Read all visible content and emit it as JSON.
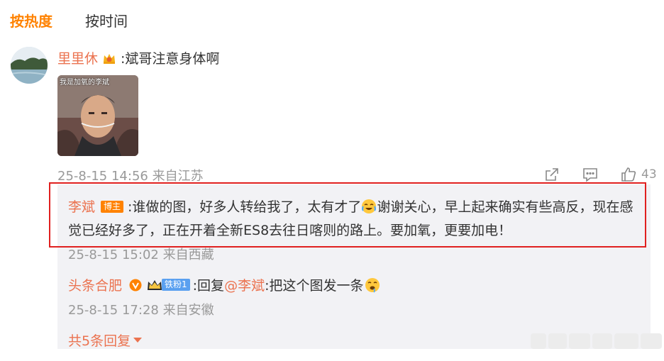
{
  "tabs": {
    "hot": "按热度",
    "time": "按时间"
  },
  "comment": {
    "username": "里里休",
    "text": ":斌哥注意身体啊",
    "image_caption": "我是加氧的李斌",
    "timestamp": "25-8-15 14:56",
    "location": "来自江苏",
    "likes": "43",
    "icons": {
      "badge": "crown-badge-icon",
      "share": "share-icon",
      "comment": "comment-icon",
      "like": "thumbs-up-icon"
    }
  },
  "reply": {
    "username": "李斌",
    "badge": "博主",
    "text_part1": ":谁做的图，好多人转给我了，太有才了",
    "text_part2": "谢谢关心，早上起来确实有些高反，现在感觉已经好多了，正在开着全新ES8去往日喀则的路上。要加氧，更要加电！",
    "timestamp": "25-8-15 15:02",
    "location": "来自西藏",
    "emoji": "laughing-crying-emoji"
  },
  "subreply": {
    "username": "头条合肥",
    "fan_badge": "铁粉1",
    "reply_prefix": ":回复",
    "mention": "@李斌",
    "text": ":把这个图发一条",
    "timestamp": "25-8-15 17:28",
    "location": "来自安徽",
    "emoji": "drooling-face-emoji"
  },
  "more_replies": "共5条回复",
  "colors": {
    "accent": "#ff8200",
    "username": "#eb7350",
    "highlight_border": "#e0201f",
    "reply_bg": "#f2f2f5",
    "meta": "#999999"
  }
}
